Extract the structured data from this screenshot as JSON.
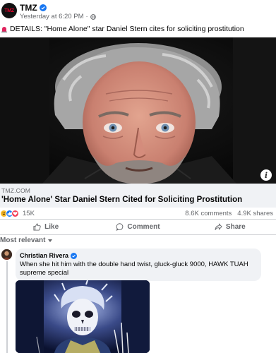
{
  "post": {
    "page_name": "TMZ",
    "page_logo_text": "TMZ",
    "time": "Yesterday at 6:20 PM",
    "text": "DETAILS: \"Home Alone\" star Daniel Stern cites for soliciting prostitution"
  },
  "link": {
    "domain": "TMZ.COM",
    "title": "'Home Alone' Star Daniel Stern Cited for Soliciting Prostitution"
  },
  "stats": {
    "reaction_count": "15K",
    "comments": "8.6K comments",
    "shares": "4.9K shares"
  },
  "actions": {
    "like": "Like",
    "comment": "Comment",
    "share": "Share"
  },
  "comments_sort": "Most relevant",
  "comment": {
    "author": "Christian Rivera",
    "text": "When she hit him with the double hand twist, gluck-gluck 9000, HAWK TUAH supreme special"
  },
  "icons": {
    "verified": "verified-badge-icon",
    "globe": "globe-icon",
    "siren": "siren-icon",
    "info": "info-icon",
    "like": "thumbs-up-icon",
    "comment": "comment-bubble-icon",
    "share": "share-arrow-icon",
    "sort": "chevron-down-icon"
  },
  "colors": {
    "accent": "#1877f2",
    "secondary_text": "#65676b",
    "link_bg": "#f0f2f5",
    "tmz_red": "#e4002b"
  }
}
